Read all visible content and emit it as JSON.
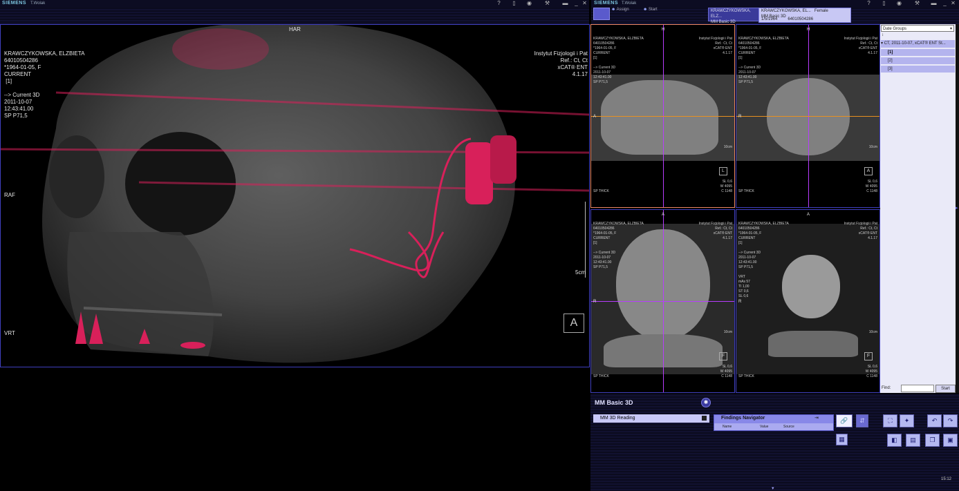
{
  "topbar": {
    "left": {
      "brand": "SIEMENS",
      "user": "T.Wolak"
    },
    "right": {
      "brand": "SIEMENS",
      "user": "T.Wolak",
      "assign": "Assign",
      "start": "Start"
    },
    "icons": [
      "help-icon",
      "phone-icon",
      "settings-icon",
      "tools-icon",
      "folder-icon",
      "minimize-icon",
      "close-icon"
    ]
  },
  "patient_tabs": [
    {
      "line1": "KRAWCZYKOWSKA, ELZ...",
      "line2": "MM Basic 3D"
    },
    {
      "name": "KRAWCZYKOWSKA, EL...",
      "sex": "Female",
      "app": "MM Basic 3D",
      "dob": "1/5/1964",
      "id": "64010504286"
    }
  ],
  "vrt_view": {
    "orient_top": "HAR",
    "orient_left": "RAF",
    "left_info": [
      "KRAWCZYKOWSKA, ELZBIETA",
      "64010504286",
      "*1964-01-05, F",
      "CURRENT",
      " [1]",
      "",
      "--> Current 3D",
      "2011-10-07",
      "12:43:41.00",
      "SP P71,5"
    ],
    "right_info": [
      "Instytut Fizjologii i Pat",
      "Ref.: Ct, Ct",
      "xCAT® ENT",
      "4.1.17"
    ],
    "scale": "5cm",
    "mode": "VRT",
    "cube_label": "A"
  },
  "mpr_views": [
    {
      "left": [
        "KRAWCZYKOWSKA, ELZBIETA",
        "64010504286",
        "*1964-01-05, F",
        "CURRENT",
        "[1]",
        "",
        "--> Current 3D",
        "2011-10-07",
        "12:43:41.00",
        "SP P71,5"
      ],
      "right": [
        "Instytut Fizjologii i Pat",
        "Ref.: Ct, Ct",
        "xCAT® ENT",
        "4.1.17"
      ],
      "top": "H",
      "left_or": "A",
      "bottom_left": "SP THICK",
      "bottom_right": [
        "SL 0,6",
        "W 4095",
        "C 1148"
      ],
      "scale": "10cm",
      "cube": "L"
    },
    {
      "left": [
        "KRAWCZYKOWSKA, ELZBIETA",
        "64010504286",
        "*1964-01-05, F",
        "CURRENT",
        "[1]",
        "",
        "--> Current 3D",
        "2011-10-07",
        "12:43:41.00",
        "SP P71,5"
      ],
      "right": [
        "Instytut Fizjologii i Pat",
        "Ref.: Ct, Ct",
        "xCAT® ENT",
        "4.1.17"
      ],
      "top": "H",
      "left_or": "R",
      "bottom_left": "SP THICK",
      "bottom_right": [
        "SL 0,6",
        "W 4095",
        "C 1148"
      ],
      "scale": "10cm",
      "cube": "A"
    },
    {
      "left": [
        "KRAWCZYKOWSKA, ELZBIETA",
        "64010504286",
        "*1964-01-05, F",
        "CURRENT",
        "[1]",
        "",
        "--> Current 3D",
        "2011-10-07",
        "12:43:41.00",
        "SP P71,5"
      ],
      "right": [
        "Instytut Fizjologii i Pat",
        "Ref.: Ct, Ct",
        "xCAT® ENT",
        "4.1.17"
      ],
      "top": "A",
      "left_or": "R",
      "bottom_left": "SP THICK",
      "bottom_right": [
        "SL 0,6",
        "W 4095",
        "C 1148"
      ],
      "scale": "10cm",
      "cube": "F"
    },
    {
      "left": [
        "KRAWCZYKOWSKA, ELZBIETA",
        "64010504286",
        "*1964-01-05, F",
        "CURRENT",
        "[1]",
        "",
        "--> Current 3D",
        "2011-10-07",
        "12:43:41.00",
        "SP P71,5",
        "",
        "VRT",
        "mAs 57",
        "TI 1,00",
        "ST 0,6",
        "SL 0,6"
      ],
      "right": [
        "Instytut Fizjologii i Pat",
        "Ref.: Ct, Ct",
        "xCAT® ENT",
        "4.1.17"
      ],
      "top": "A",
      "left_or": "R",
      "bottom_left": "SP THICK",
      "bottom_right": [
        "SL 0,6",
        "W 4095",
        "C 1148"
      ],
      "scale": "10cm",
      "cube": "F"
    }
  ],
  "series_panel": {
    "dropdown": "Date Groups",
    "group": "CT, 2011-10-07, xCAT® ENT St...",
    "items": [
      "[1]",
      "[2]",
      "[3]"
    ],
    "find_label": "Find:",
    "start_button": "Start"
  },
  "bottom": {
    "title": "MM Basic 3D",
    "reading_tab": "MM 3D Reading",
    "findings": {
      "title": "Findings Navigator",
      "columns": [
        "Name",
        "Value",
        "Source"
      ]
    },
    "time": "15:12"
  },
  "colors": {
    "accent": "#7070e0",
    "highlight": "#d8205a",
    "crosshair_v": "#b83cff",
    "crosshair_h": "#e89020"
  }
}
